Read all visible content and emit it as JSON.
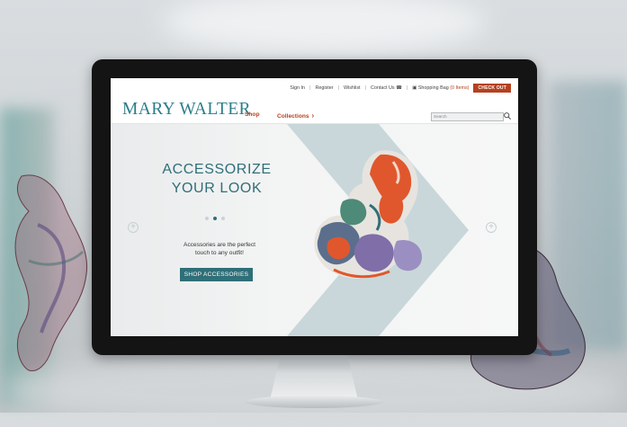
{
  "header": {
    "util_links": [
      "Sign In",
      "Register",
      "Wishlist"
    ],
    "contact_label": "Contact Us",
    "bag_label": "Shopping Bag",
    "bag_count": "(0 Items)",
    "checkout_label": "CHECK OUT",
    "logo": "MARY WALTER",
    "nav": {
      "shop": "Shop",
      "collections": "Collections"
    },
    "search_placeholder": "Search"
  },
  "hero": {
    "headline_line1": "ACCESSORIZE",
    "headline_line2": "YOUR LOOK",
    "sub_line1": "Accessories are the perfect",
    "sub_line2": "touch to any outfit!",
    "cta_label": "SHOP ACCESSORIES",
    "slide_count": 3,
    "active_slide": 2
  },
  "colors": {
    "brand_teal": "#2f6f78",
    "accent_rust": "#b5411f",
    "chevron_bg": "#c9d7da"
  },
  "icons": [
    "phone-icon",
    "bag-icon",
    "search-icon",
    "prev-arrow-icon",
    "next-arrow-icon"
  ]
}
